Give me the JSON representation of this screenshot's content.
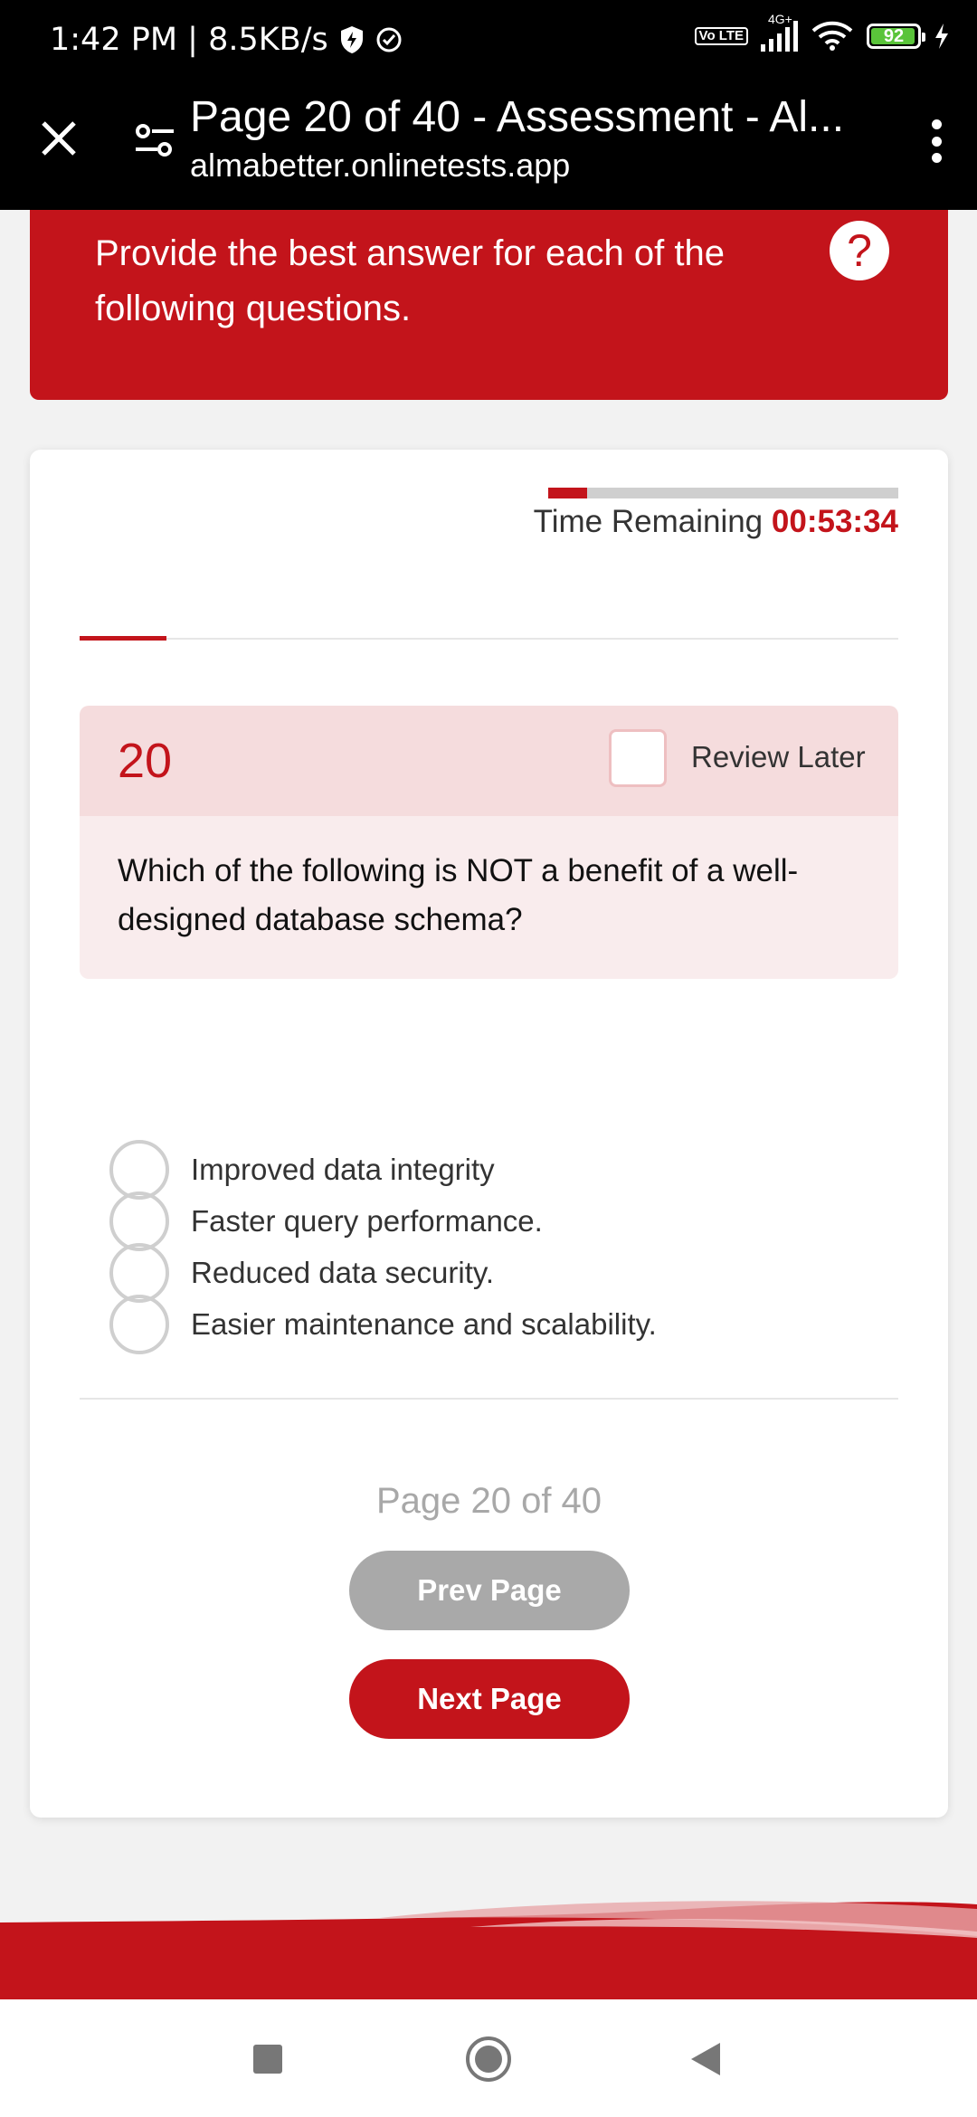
{
  "status_bar": {
    "time_speed": "1:42 PM | 8.5KB/s",
    "network": "4G+",
    "volte": "Vo LTE",
    "battery": "92"
  },
  "browser": {
    "title": "Page 20 of 40 - Assessment - Al...",
    "url": "almabetter.onlinetests.app"
  },
  "banner": {
    "instructions": "Provide the best answer for each of the following questions.",
    "help": "?"
  },
  "timer": {
    "label": "Time Remaining ",
    "value": "00:53:34",
    "progress_fraction": 0.11
  },
  "question": {
    "number": "20",
    "review_label": "Review Later",
    "text": "Which of the following is NOT a benefit of a well-designed database schema?",
    "options": [
      "Improved data integrity",
      "Faster query performance.",
      "Reduced data security.",
      "Easier maintenance and scalability."
    ]
  },
  "pagination": {
    "page_info": "Page 20 of 40",
    "prev_label": "Prev Page",
    "next_label": "Next Page"
  },
  "colors": {
    "accent": "#c3141b",
    "muted_button": "#a9a9a9"
  }
}
